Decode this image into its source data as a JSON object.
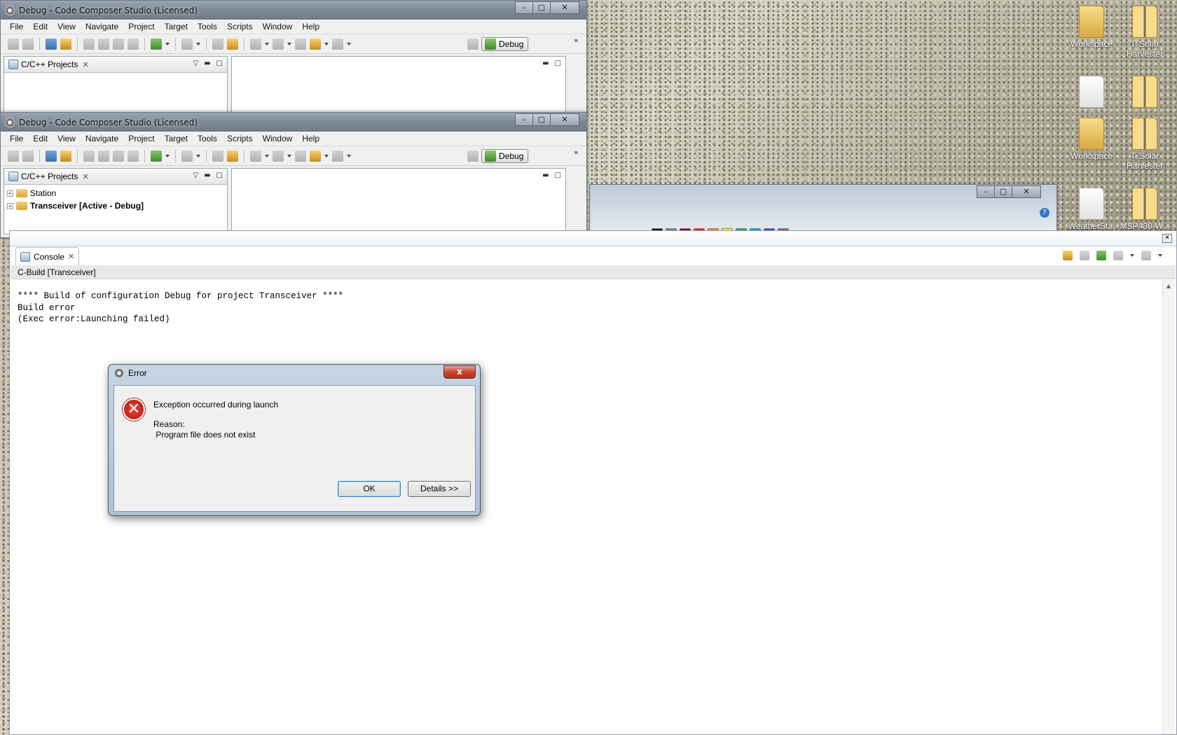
{
  "desktop": {
    "icons_top": [
      {
        "label": "Workspace",
        "type": "folder"
      },
      {
        "label": "Ti Solar Harvester",
        "type": "folder"
      }
    ],
    "icons_row2": [
      {
        "label": "",
        "type": "doc"
      },
      {
        "label": "",
        "type": "zip"
      }
    ],
    "icons_mid": [
      {
        "label": "Workspace",
        "type": "folder"
      },
      {
        "label": "Ti Solar Harvester",
        "type": "folder"
      }
    ],
    "icons_bottom": [
      {
        "label": "WeatherSt...",
        "type": "doc"
      },
      {
        "label": "MSP430-W...",
        "type": "zip"
      }
    ]
  },
  "window_back": {
    "title": "Debug - Code Composer Studio (Licensed)",
    "menu": [
      "File",
      "Edit",
      "View",
      "Navigate",
      "Project",
      "Target",
      "Tools",
      "Scripts",
      "Window",
      "Help"
    ],
    "perspective": "Debug",
    "projects_tab": "C/C++ Projects"
  },
  "window_front": {
    "title": "Debug - Code Composer Studio (Licensed)",
    "menu": [
      "File",
      "Edit",
      "View",
      "Navigate",
      "Project",
      "Target",
      "Tools",
      "Scripts",
      "Window",
      "Help"
    ],
    "perspective": "Debug",
    "projects_tab": "C/C++ Projects",
    "tree": [
      "Station",
      "Transceiver  [Active - Debug]"
    ]
  },
  "console": {
    "tab": "Console",
    "subtitle": "C-Build [Transceiver]",
    "lines": [
      "**** Build of configuration Debug for project Transceiver ****",
      "",
      "Build error",
      "(Exec error:Launching failed)"
    ]
  },
  "dialog": {
    "title": "Error",
    "close": "x",
    "message": "Exception occurred during launch",
    "reason_label": "Reason:",
    "reason": " Program file does not exist",
    "ok": "OK",
    "details": "Details >>"
  },
  "colors": {
    "accent": "#3c7fb1",
    "error": "#c9452f"
  }
}
